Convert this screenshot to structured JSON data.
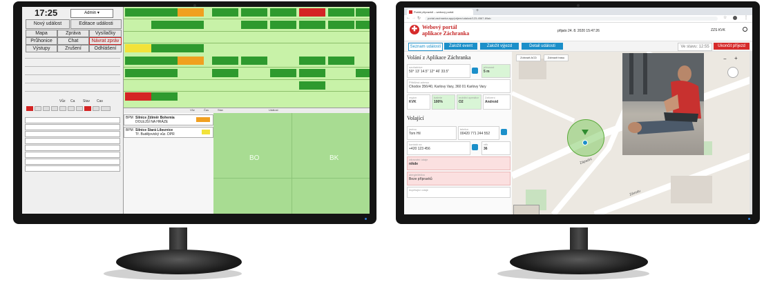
{
  "left_app": {
    "clock": "17:25",
    "user_select": "Admin",
    "new_event": "Nový událost",
    "edit_event": "Editace události",
    "menu": [
      "Mapa",
      "Zpráva",
      "Vysílačky",
      "Průhonice",
      "Chat",
      "Návrat zpráv",
      "Výstupy",
      "Zrušení",
      "Odhlášení"
    ],
    "units_header": [
      "Vůz",
      "Ca",
      "Stav",
      "Cas"
    ],
    "event_tab_labels": [
      "Vůz",
      "Čas",
      "Stav",
      "Událost"
    ],
    "events": [
      {
        "id": "BPM",
        "text": "Silnice Zdiměr Bohemia",
        "sub": "DOLEJŠÍ NA HRÁZE"
      },
      {
        "id": "BPM",
        "text": "Silnice Stará Líbeznice",
        "sub": "Tř. Budějovický vůz. DPR"
      }
    ],
    "map_labels": [
      "BO",
      "BK"
    ]
  },
  "right_app": {
    "tab_title": "Portál přípravků – webový portál",
    "url": "portal.zachranka.app/prijem/udalost/123-4567-89ab",
    "brand_line1": "Webový portál",
    "brand_line2": "aplikace Záchranka",
    "received": "přijato 24. 8. 2020 15:47:26",
    "user": "ZZS KVK",
    "nav_buttons": [
      "Seznam událostí",
      "Založit event",
      "Založit výjezd",
      "Detail události"
    ],
    "status_box": "Ve stavu: 12:55",
    "end_button": "Ukončit příjezd",
    "section_call": "Volání z Aplikace Záchranka",
    "coordinates_label": "souřadnice",
    "coordinates": "50° 13' 14.5\" 12° 46' 33.5\"",
    "accuracy_label": "přesnost",
    "accuracy": "5 m",
    "address_label": "Přibližná adresa",
    "address": "Chodov 356/40, Karlovy Vary, 360 01 Karlovy Vary",
    "region_label": "region",
    "region": "KVK",
    "battery_label": "baterie",
    "battery": "100%",
    "app_label": "mobilní operátor",
    "app": "O2",
    "platform_label": "Zařízení",
    "platform": "Android",
    "section_caller": "Volající",
    "name_label": "jméno",
    "name": "Tom Hil",
    "phone_label": "telefon",
    "phone": "00420 771 244 552",
    "contact_label": "kontakt na",
    "contact": "+420 123 456",
    "age_label": "věk",
    "age": "36",
    "health_label": "zdravotní údaje",
    "health": "nikde",
    "allergy_label": "alergie/léčba",
    "allergy": "Beze přípravků",
    "other_label": "doplňující údaje",
    "map_btn_1": "Zobrazit ACD",
    "map_btn_2": "Zobrazit trasu",
    "streets": [
      "Západní",
      "Závodu"
    ]
  },
  "colors": {
    "accent_red": "#d62b2b",
    "nav_blue": "#1b8fc9",
    "left_green": "#c8f2a8",
    "tile_green": "#2e9a2e"
  }
}
